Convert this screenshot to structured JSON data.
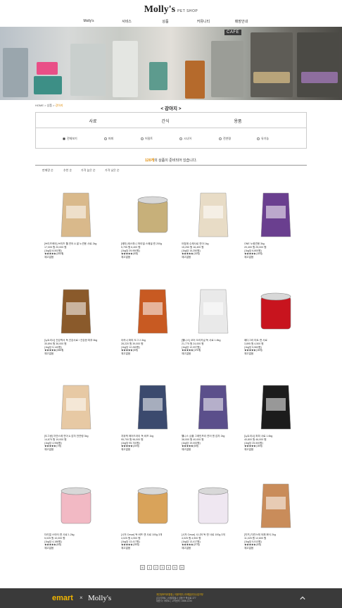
{
  "header": {
    "logo_main": "Molly's",
    "logo_sub": "PET SHOP",
    "nav": [
      "Molly's",
      "서비스",
      "상품",
      "커뮤니티",
      "매장안내"
    ]
  },
  "hero": {
    "sign": "CAFE"
  },
  "breadcrumb": {
    "home": "HOME",
    "sep1": ">",
    "mid": "상품",
    "sep2": ">",
    "current": "강아지"
  },
  "page_title": "< 강아지 >",
  "filter": {
    "categories": [
      "사료",
      "간식",
      "용품"
    ],
    "options": [
      "전체보기",
      "퍼피",
      "어덜트",
      "시니어",
      "전연령",
      "유기농"
    ]
  },
  "count": {
    "num": "120개",
    "text": "의 상품이 준비되어 있습니다."
  },
  "sort": [
    "판매량 순",
    "추천 순",
    "가격 높은 순",
    "가격 낮은 순"
  ],
  "products": [
    {
      "name": "[브리츠케어] 브리츠 웰 연어 & 쌀 노견용 사료 2kg",
      "price": "17,005 원 20,000 원",
      "unit": "(1kg당 8,502원)",
      "rating": "★★★★★ (203개)",
      "stock": "재고없음",
      "color": "#d9b98b"
    },
    {
      "name": "[테마] 테스파니 하이빌 스페셜 캔 200g",
      "price": "5,795 원 6,400 원",
      "unit": "(1kg당 29,950원)",
      "rating": "★★★★★ (5개)",
      "stock": "재고없음",
      "color": "#c7b07a"
    },
    {
      "name": "아침애 수제사료 연어 1kg",
      "price": "15,250 원 16,400 원",
      "unit": "(1kg당 15,250원)",
      "rating": "★★★★★ (13개)",
      "stock": "재고없음",
      "color": "#e8dcc6"
    },
    {
      "name": "ONE 노령견용 3kg",
      "price": "20,400 원 25,000 원",
      "unit": "(1kg당 6,800원)",
      "rating": "★★★★★ (10개)",
      "stock": "재고없음",
      "color": "#6a3f8f"
    },
    {
      "name": "[뉴트리나] 건강백서 독 건강사료 / 건강한 피부 6kg",
      "price": "30,894 원 36,000 원",
      "unit": "(1kg당 5,149원)",
      "rating": "★★★★★ (308개)",
      "stock": "재고없음",
      "color": "#8a5a2b"
    },
    {
      "name": "아카나 퍼피 도그 2.3kg",
      "price": "28,220 원 39,000 원",
      "unit": "(1kg당 12,269원)",
      "rating": "★★★★★ (5개)",
      "stock": "재고없음",
      "color": "#c85a22"
    },
    {
      "name": "[웰니스] 코어 오리지널 독 사료 1.8kg",
      "price": "21,775 원 24,000 원",
      "unit": "(1kg당 12,097원)",
      "rating": "★★★★★ (175개)",
      "stock": "재고없음",
      "color": "#e9e9e9"
    },
    {
      "name": "페디그리 미트 캔 사료",
      "price": "3,895 원 4,500 원",
      "unit": "(1kg당 5,563원)",
      "rating": "★★★★★ (15개)",
      "stock": "재고없음",
      "color": "#c8141e"
    },
    {
      "name": "[도그랑] 자연스레 연어 & 감자 전연령 3kg",
      "price": "14,875 원 19,000 원",
      "unit": "(1kg당 4,958원)",
      "rating": "★★★★★ (7개)",
      "stock": "재고없음",
      "color": "#e7c9a4"
    },
    {
      "name": "지위픽 에어드라이 독 비프 1kg",
      "price": "95,700 원 96,000 원",
      "unit": "(1kg당 95,700원)",
      "rating": "★★★★★ (20개)",
      "stock": "재고없음",
      "color": "#3b4a6e"
    },
    {
      "name": "웰니스 심플 그레인프리 연어 앤 감자 2kg",
      "price": "38,000 원 40,000 원",
      "unit": "(1kg당 19,000원)",
      "rating": "★★★★★ (5개)",
      "stock": "재고없음",
      "color": "#5b4f8b"
    },
    {
      "name": "[뉴트리나] 퍼피 사료 1.6kg",
      "price": "40,800 원 46,000 원",
      "unit": "(1kg당 25,500원)",
      "rating": "★★★★★ (15개)",
      "stock": "재고없음",
      "color": "#1c1c1c"
    },
    {
      "name": "더리얼 스타터 캔 사료 1.2kg",
      "price": "5,025 원 10,000 원",
      "unit": "(1kg당 4,188원)",
      "rating": "★★★★★ (5개)",
      "stock": "재고없음",
      "color": "#f2b9c4"
    },
    {
      "name": "[시저 Cesar] 독 비프 캔 사료 100g 3개",
      "price": "4,025 원 4,900 원",
      "unit": "(1kg당 13,417원)",
      "rating": "★★★★★ (25개)",
      "stock": "재고없음",
      "color": "#d9a35a"
    },
    {
      "name": "[시저 Cesar] 시니어 독 캔 사료 100g 3개",
      "price": "4,025 원 4,900 원",
      "unit": "(1kg당 13,417원)",
      "rating": "★★★★★ (27개)",
      "stock": "재고없음",
      "color": "#efe7f1"
    },
    {
      "name": "[잇츠] 자연스레 야채 화식 2kg",
      "price": "11,025 원 12,600 원",
      "unit": "(1kg당 5,513원)",
      "rating": "★★★★★ (5개)",
      "stock": "재고없음",
      "color": "#c98c5a"
    }
  ],
  "pager": [
    "«",
    "1",
    "2",
    "3",
    "4",
    "5",
    "»"
  ],
  "footer": {
    "brand1": "emart",
    "x": "×",
    "brand2": "Molly's",
    "lines": [
      "개인정보처리방침 | 이용약관 | 이메일무단수집거부",
      "(주)이마트 | 서울특별시 성동구 뚝섬로 377",
      "대표자: 이마트 | 고객센터: 1588-1234"
    ]
  }
}
